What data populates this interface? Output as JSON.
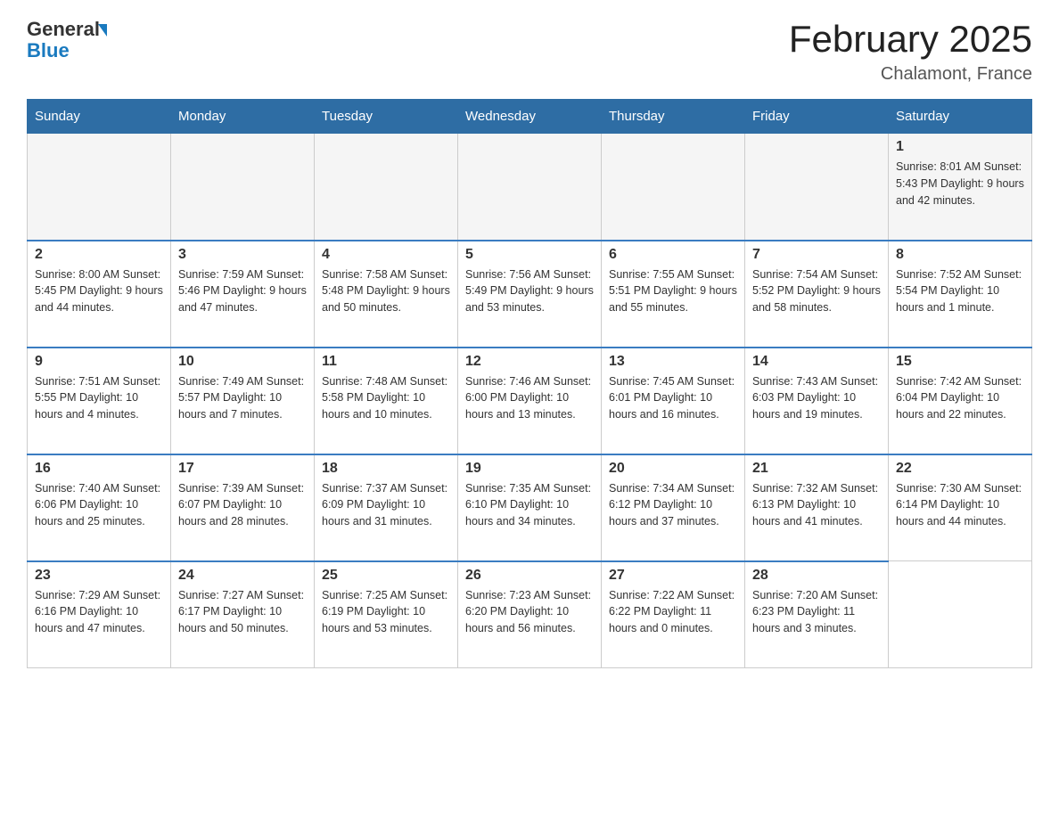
{
  "header": {
    "logo_general": "General",
    "logo_blue": "Blue",
    "title": "February 2025",
    "subtitle": "Chalamont, France"
  },
  "weekdays": [
    "Sunday",
    "Monday",
    "Tuesday",
    "Wednesday",
    "Thursday",
    "Friday",
    "Saturday"
  ],
  "weeks": [
    [
      {
        "day": "",
        "info": ""
      },
      {
        "day": "",
        "info": ""
      },
      {
        "day": "",
        "info": ""
      },
      {
        "day": "",
        "info": ""
      },
      {
        "day": "",
        "info": ""
      },
      {
        "day": "",
        "info": ""
      },
      {
        "day": "1",
        "info": "Sunrise: 8:01 AM\nSunset: 5:43 PM\nDaylight: 9 hours\nand 42 minutes."
      }
    ],
    [
      {
        "day": "2",
        "info": "Sunrise: 8:00 AM\nSunset: 5:45 PM\nDaylight: 9 hours\nand 44 minutes."
      },
      {
        "day": "3",
        "info": "Sunrise: 7:59 AM\nSunset: 5:46 PM\nDaylight: 9 hours\nand 47 minutes."
      },
      {
        "day": "4",
        "info": "Sunrise: 7:58 AM\nSunset: 5:48 PM\nDaylight: 9 hours\nand 50 minutes."
      },
      {
        "day": "5",
        "info": "Sunrise: 7:56 AM\nSunset: 5:49 PM\nDaylight: 9 hours\nand 53 minutes."
      },
      {
        "day": "6",
        "info": "Sunrise: 7:55 AM\nSunset: 5:51 PM\nDaylight: 9 hours\nand 55 minutes."
      },
      {
        "day": "7",
        "info": "Sunrise: 7:54 AM\nSunset: 5:52 PM\nDaylight: 9 hours\nand 58 minutes."
      },
      {
        "day": "8",
        "info": "Sunrise: 7:52 AM\nSunset: 5:54 PM\nDaylight: 10 hours\nand 1 minute."
      }
    ],
    [
      {
        "day": "9",
        "info": "Sunrise: 7:51 AM\nSunset: 5:55 PM\nDaylight: 10 hours\nand 4 minutes."
      },
      {
        "day": "10",
        "info": "Sunrise: 7:49 AM\nSunset: 5:57 PM\nDaylight: 10 hours\nand 7 minutes."
      },
      {
        "day": "11",
        "info": "Sunrise: 7:48 AM\nSunset: 5:58 PM\nDaylight: 10 hours\nand 10 minutes."
      },
      {
        "day": "12",
        "info": "Sunrise: 7:46 AM\nSunset: 6:00 PM\nDaylight: 10 hours\nand 13 minutes."
      },
      {
        "day": "13",
        "info": "Sunrise: 7:45 AM\nSunset: 6:01 PM\nDaylight: 10 hours\nand 16 minutes."
      },
      {
        "day": "14",
        "info": "Sunrise: 7:43 AM\nSunset: 6:03 PM\nDaylight: 10 hours\nand 19 minutes."
      },
      {
        "day": "15",
        "info": "Sunrise: 7:42 AM\nSunset: 6:04 PM\nDaylight: 10 hours\nand 22 minutes."
      }
    ],
    [
      {
        "day": "16",
        "info": "Sunrise: 7:40 AM\nSunset: 6:06 PM\nDaylight: 10 hours\nand 25 minutes."
      },
      {
        "day": "17",
        "info": "Sunrise: 7:39 AM\nSunset: 6:07 PM\nDaylight: 10 hours\nand 28 minutes."
      },
      {
        "day": "18",
        "info": "Sunrise: 7:37 AM\nSunset: 6:09 PM\nDaylight: 10 hours\nand 31 minutes."
      },
      {
        "day": "19",
        "info": "Sunrise: 7:35 AM\nSunset: 6:10 PM\nDaylight: 10 hours\nand 34 minutes."
      },
      {
        "day": "20",
        "info": "Sunrise: 7:34 AM\nSunset: 6:12 PM\nDaylight: 10 hours\nand 37 minutes."
      },
      {
        "day": "21",
        "info": "Sunrise: 7:32 AM\nSunset: 6:13 PM\nDaylight: 10 hours\nand 41 minutes."
      },
      {
        "day": "22",
        "info": "Sunrise: 7:30 AM\nSunset: 6:14 PM\nDaylight: 10 hours\nand 44 minutes."
      }
    ],
    [
      {
        "day": "23",
        "info": "Sunrise: 7:29 AM\nSunset: 6:16 PM\nDaylight: 10 hours\nand 47 minutes."
      },
      {
        "day": "24",
        "info": "Sunrise: 7:27 AM\nSunset: 6:17 PM\nDaylight: 10 hours\nand 50 minutes."
      },
      {
        "day": "25",
        "info": "Sunrise: 7:25 AM\nSunset: 6:19 PM\nDaylight: 10 hours\nand 53 minutes."
      },
      {
        "day": "26",
        "info": "Sunrise: 7:23 AM\nSunset: 6:20 PM\nDaylight: 10 hours\nand 56 minutes."
      },
      {
        "day": "27",
        "info": "Sunrise: 7:22 AM\nSunset: 6:22 PM\nDaylight: 11 hours\nand 0 minutes."
      },
      {
        "day": "28",
        "info": "Sunrise: 7:20 AM\nSunset: 6:23 PM\nDaylight: 11 hours\nand 3 minutes."
      },
      {
        "day": "",
        "info": ""
      }
    ]
  ]
}
